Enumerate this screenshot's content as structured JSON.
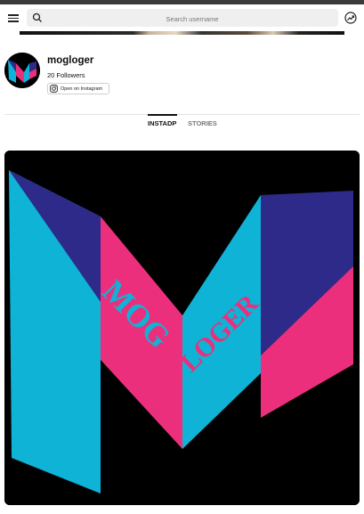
{
  "header": {
    "search_placeholder": "Search username"
  },
  "profile": {
    "username": "mogloger",
    "followers": "20 Followers",
    "open_button_label": "Open on Instagram"
  },
  "tabs": [
    {
      "label": "INSTADP",
      "active": true
    },
    {
      "label": "STORIES",
      "active": false
    }
  ],
  "post": {
    "logo_text_left": "MOG",
    "logo_text_right": "LOGER"
  },
  "colors": {
    "cyan": "#0fb3d6",
    "pink": "#ec2f7c",
    "navy": "#2e2a8a",
    "post_bg": "#000000"
  }
}
